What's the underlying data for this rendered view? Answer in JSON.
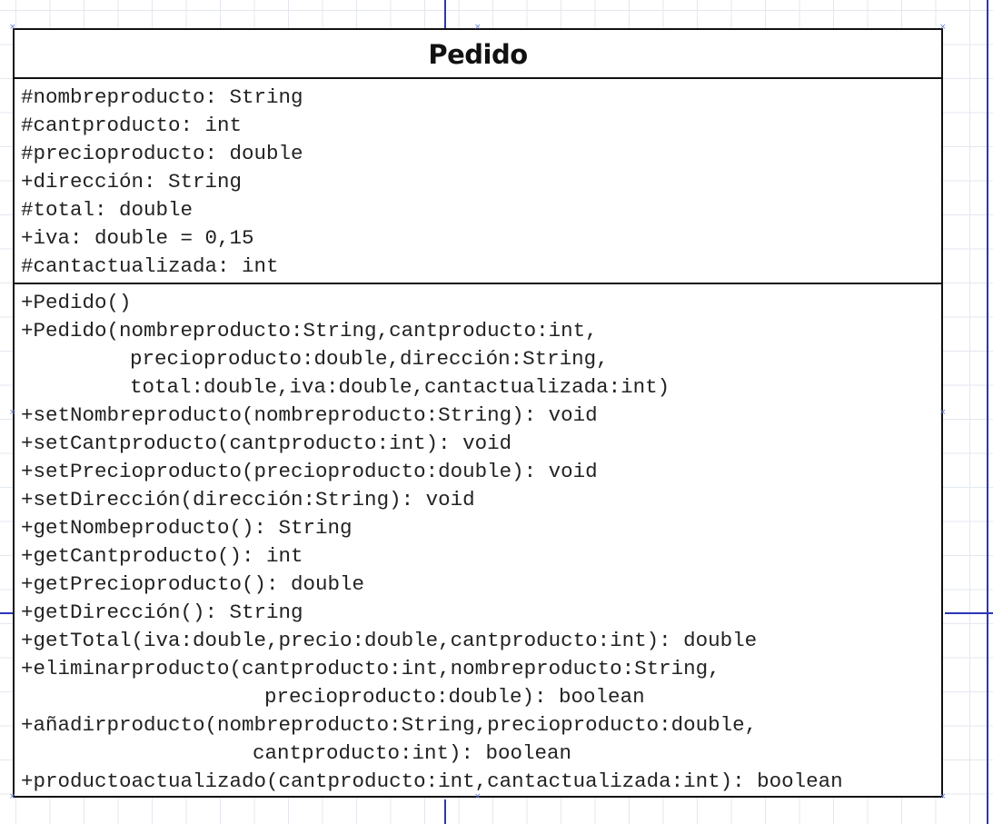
{
  "class": {
    "name": "Pedido",
    "attributes": [
      "#nombreproducto: String",
      "#cantproducto: int",
      "#precioproducto: double",
      "+dirección: String",
      "#total: double",
      "+iva: double = 0,15",
      "#cantactualizada: int"
    ],
    "operations": [
      "+Pedido()",
      "+Pedido(nombreproducto:String,cantproducto:int,",
      "precioproducto:double,dirección:String,",
      "total:double,iva:double,cantactualizada:int)",
      "+setNombreproducto(nombreproducto:String): void",
      "+setCantproducto(cantproducto:int): void",
      "+setPrecioproducto(precioproducto:double): void",
      "+setDirección(dirección:String): void",
      "+getNombeproducto(): String",
      "+getCantproducto(): int",
      "+getPrecioproducto(): double",
      "+getDirección(): String",
      "+getTotal(iva:double,precio:double,cantproducto:int): double",
      "+eliminarproducto(cantproducto:int,nombreproducto:String,",
      "precioproducto:double): boolean",
      "+añadirproducto(nombreproducto:String,precioproducto:double,",
      "cantproducto:int): boolean",
      "+productoactualizado(cantproducto:int,cantactualizada:int): boolean"
    ]
  },
  "colors": {
    "border": "#111111",
    "guide_line": "#2b37b8",
    "grid": "#e3e7ef",
    "handle": "#6a7fd6"
  },
  "icons": {
    "handle": "x-handle-icon"
  }
}
